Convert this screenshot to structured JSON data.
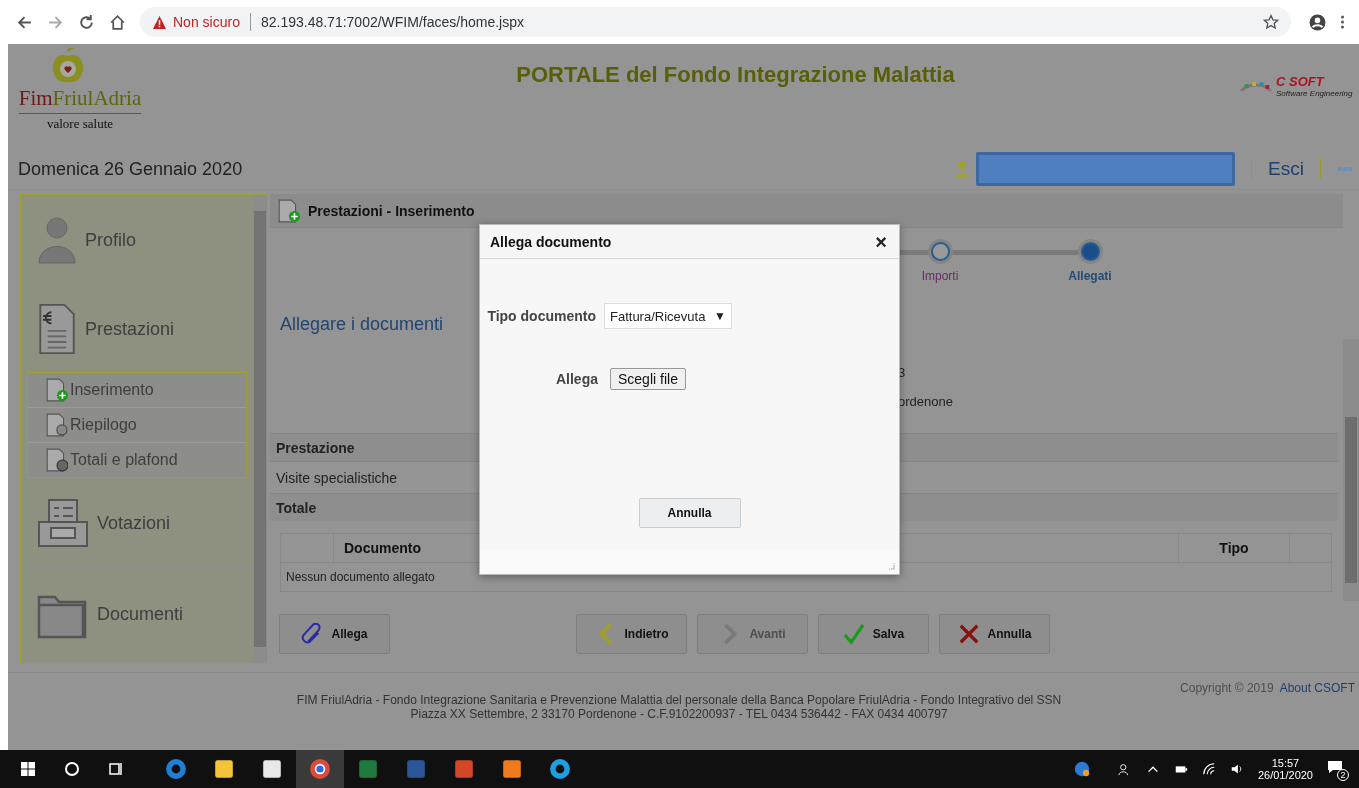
{
  "browser": {
    "security": "Non sicuro",
    "url": "82.193.48.71:7002/WFIM/faces/home.jspx"
  },
  "header": {
    "brand": [
      "Fim",
      "FriulAdria"
    ],
    "slogan": "valore salute",
    "title": "PORTALE del Fondo Integrazione Malattia",
    "vendor": "C SOFT",
    "vendor_tagline": "Software Engineering",
    "date": "Domenica 26 Gennaio 2020",
    "logout": "Esci"
  },
  "sidebar": {
    "items": [
      {
        "label": "Profilo",
        "kind": "profile"
      },
      {
        "label": "Prestazioni",
        "kind": "invoice",
        "children": [
          {
            "label": "Inserimento",
            "kind": "add"
          },
          {
            "label": "Riepilogo",
            "kind": "list"
          },
          {
            "label": "Totali e plafond",
            "kind": "totals"
          }
        ]
      },
      {
        "label": "Votazioni",
        "kind": "vote"
      },
      {
        "label": "Documenti",
        "kind": "folder"
      }
    ]
  },
  "content": {
    "title": "Prestazioni - Inserimento",
    "steps": [
      {
        "label": "Importi",
        "selected": false
      },
      {
        "label": "Allegati",
        "selected": true
      }
    ],
    "heading": "Allegare i documenti",
    "partial_lines": [
      "3",
      "ordenone"
    ],
    "summary": [
      {
        "text": "Prestazione",
        "kind": "header"
      },
      {
        "text": "Visite specialistiche",
        "kind": "row"
      },
      {
        "text": "Totale",
        "kind": "header"
      }
    ],
    "documents": {
      "columns": [
        "Documento",
        "Tipo"
      ],
      "empty": "Nessun documento allegato"
    },
    "buttons": [
      {
        "label": "Allega",
        "kind": "attach",
        "disabled": false
      },
      {
        "label": "Indietro",
        "kind": "back",
        "disabled": false
      },
      {
        "label": "Avanti",
        "kind": "next",
        "disabled": true
      },
      {
        "label": "Salva",
        "kind": "save",
        "disabled": false
      },
      {
        "label": "Annulla",
        "kind": "cancel",
        "disabled": false
      }
    ]
  },
  "footer": {
    "lines": [
      "FIM FriulAdria - Fondo Integrazione Sanitaria e Prevenzione Malattia del personale della Banca Popolare FriulAdria - Fondo Integrativo del SSN",
      "Piazza XX Settembre, 2 33170 Pordenone - C.F.9102200937 - TEL 0434 536442 - FAX 0434 400797"
    ],
    "copyright": "Copyright © 2019",
    "about": "About CSOFT"
  },
  "dialog": {
    "title": "Allega documento",
    "close": "×",
    "fields": [
      {
        "label": "Tipo documento",
        "kind": "select",
        "value": "Fattura/Ricevuta",
        "caret": "▼"
      },
      {
        "label": "Allega",
        "kind": "file",
        "button": "Scegli file"
      }
    ],
    "cancel": "Annulla"
  },
  "taskbar": {
    "time": "15:57",
    "date": "26/01/2020",
    "notifications": "2"
  }
}
